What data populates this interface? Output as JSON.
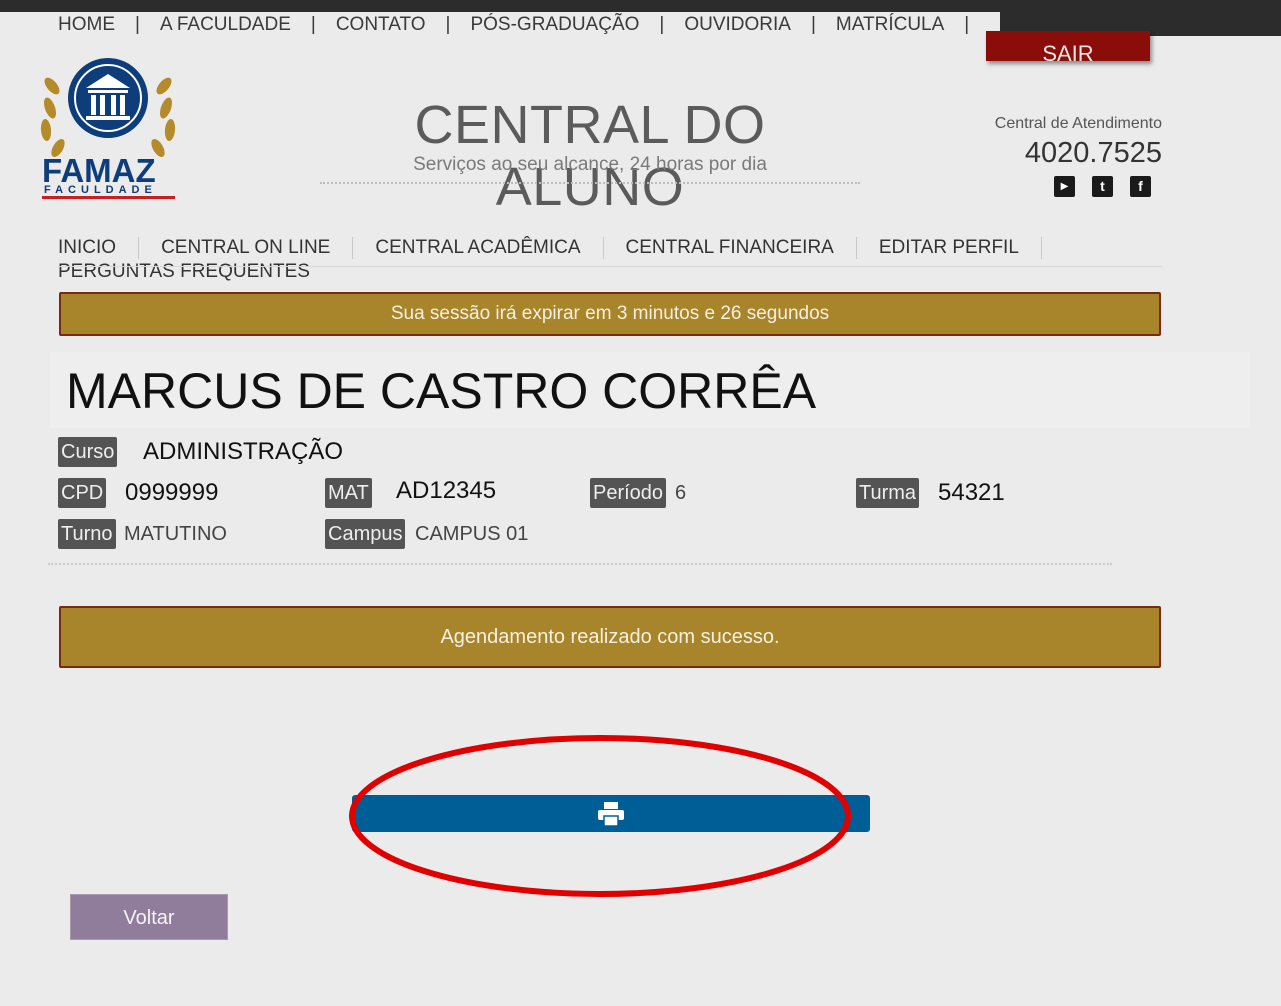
{
  "topnav": [
    "HOME",
    "A FACULDADE",
    "CONTATO",
    "PÓS-GRADUAÇÃO",
    "OUVIDORIA",
    "MATRÍCULA"
  ],
  "sair_label": "SAIR",
  "logo": {
    "name": "FAMAZ",
    "sub": "FACULDADE"
  },
  "header": {
    "title": "CENTRAL DO ALUNO",
    "subtitle": "Serviços ao seu alcance, 24 horas por dia"
  },
  "contact": {
    "label": "Central de Atendimento",
    "phone": "4020.7525"
  },
  "social": [
    {
      "icon": "youtube-icon",
      "glyph": "▶"
    },
    {
      "icon": "twitter-icon",
      "glyph": "t"
    },
    {
      "icon": "facebook-icon",
      "glyph": "f"
    }
  ],
  "menu": [
    "INICIO",
    "CENTRAL ON LINE",
    "CENTRAL ACADÊMICA",
    "CENTRAL FINANCEIRA",
    "EDITAR PERFIL",
    "PERGUNTAS FREQUENTES"
  ],
  "session_message": "Sua sessão irá expirar em 3 minutos e 26 segundos",
  "student": {
    "name": "MARCUS DE CASTRO CORRÊA",
    "curso_label": "Curso",
    "curso": "ADMINISTRAÇÃO",
    "cpd_label": "CPD",
    "cpd": "0999999",
    "mat_label": "MAT",
    "mat": "AD12345",
    "periodo_label": "Período",
    "periodo": "6",
    "turma_label": "Turma",
    "turma": "54321",
    "turno_label": "Turno",
    "turno": "MATUTINO",
    "campus_label": "Campus",
    "campus": "CAMPUS 01"
  },
  "success_message": "Agendamento realizado com sucesso.",
  "print_icon": "printer-icon",
  "voltar_label": "Voltar",
  "colors": {
    "gold": "#a8842a",
    "sair": "#8b0d0a",
    "print": "#005e96",
    "voltar": "#907d9c",
    "highlight": "#e00000"
  }
}
